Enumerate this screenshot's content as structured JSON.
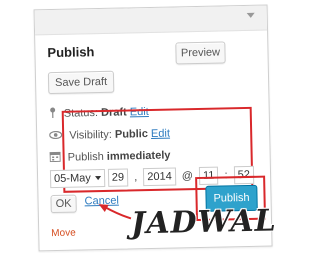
{
  "publish_box": {
    "title": "Publish",
    "save_draft_label": "Save Draft",
    "preview_label": "Preview",
    "status_label": "Status:",
    "status_value": "Draft",
    "status_edit": "Edit",
    "visibility_label": "Visibility:",
    "visibility_value": "Public",
    "visibility_edit": "Edit",
    "schedule_label": "Publish",
    "schedule_value": "immediately",
    "month": "05-May",
    "day": "29",
    "year": "2014",
    "at": "@",
    "hour": "11",
    "minute": "52",
    "ok_label": "OK",
    "cancel_label": "Cancel",
    "publish_label": "Publish",
    "move_to_trash": "Move"
  },
  "watermark": "JADWAL",
  "colors": {
    "highlight": "#d9282b",
    "primary_button": "#2ea2cc",
    "link": "#2e7bbf",
    "trash_link": "#d54e21"
  }
}
